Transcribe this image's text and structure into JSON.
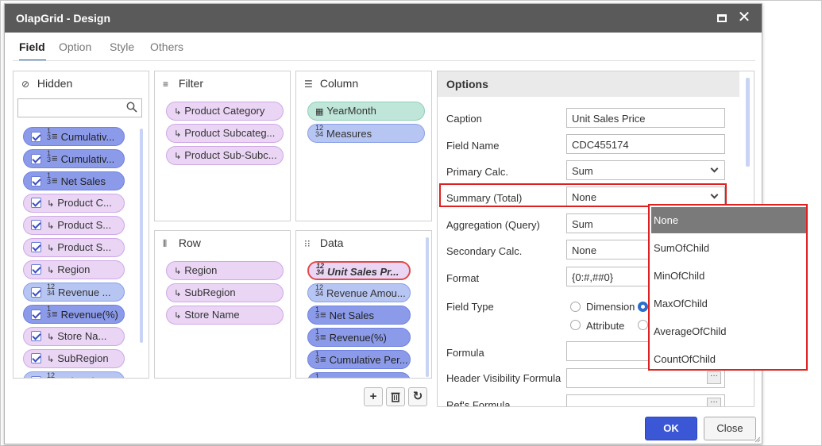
{
  "window": {
    "title": "OlapGrid - Design"
  },
  "tabs": [
    {
      "label": "Field",
      "active": true
    },
    {
      "label": "Option",
      "active": false
    },
    {
      "label": "Style",
      "active": false
    },
    {
      "label": "Others",
      "active": false
    }
  ],
  "hidden": {
    "title": "Hidden",
    "search_placeholder": "",
    "items": [
      {
        "label": "Cumulativ...",
        "icon": "measure-icon",
        "style": "blue-strong"
      },
      {
        "label": "Cumulativ...",
        "icon": "measure-icon",
        "style": "blue-strong"
      },
      {
        "label": "Net Sales",
        "icon": "measure-icon",
        "style": "blue-strong"
      },
      {
        "label": "Product C...",
        "icon": "dimension-icon",
        "style": "purple"
      },
      {
        "label": "Product S...",
        "icon": "dimension-icon",
        "style": "purple"
      },
      {
        "label": "Product S...",
        "icon": "dimension-icon",
        "style": "purple"
      },
      {
        "label": "Region",
        "icon": "dimension-icon",
        "style": "purple"
      },
      {
        "label": "Revenue ...",
        "icon": "number-icon",
        "style": "blue"
      },
      {
        "label": "Revenue(%)",
        "icon": "measure-icon",
        "style": "blue-strong"
      },
      {
        "label": "Store Na...",
        "icon": "dimension-icon",
        "style": "purple"
      },
      {
        "label": "SubRegion",
        "icon": "dimension-icon",
        "style": "purple"
      },
      {
        "label": "Unit Sales",
        "icon": "number-icon",
        "style": "blue"
      }
    ]
  },
  "filter": {
    "title": "Filter",
    "items": [
      {
        "label": "Product Category"
      },
      {
        "label": "Product Subcateg..."
      },
      {
        "label": "Product Sub-Subc..."
      }
    ]
  },
  "column": {
    "title": "Column",
    "items": [
      {
        "label": "YearMonth",
        "icon": "calendar-icon",
        "style": "teal"
      },
      {
        "label": "Measures",
        "icon": "number-icon",
        "style": "blue"
      }
    ]
  },
  "row": {
    "title": "Row",
    "items": [
      {
        "label": "Region"
      },
      {
        "label": "SubRegion"
      },
      {
        "label": "Store Name"
      }
    ]
  },
  "data": {
    "title": "Data",
    "items": [
      {
        "label": "Unit Sales Pr...",
        "icon": "number-icon",
        "style": "selected"
      },
      {
        "label": "Revenue Amou...",
        "icon": "number-icon",
        "style": "blue"
      },
      {
        "label": "Net Sales",
        "icon": "measure-icon",
        "style": "blue-strong"
      },
      {
        "label": "Revenue(%)",
        "icon": "measure-icon",
        "style": "blue-strong"
      },
      {
        "label": "Cumulative Per...",
        "icon": "measure-icon",
        "style": "blue-strong"
      },
      {
        "label": "Cumulative Per...",
        "icon": "measure-icon",
        "style": "blue-strong"
      }
    ]
  },
  "icons": {
    "measure": "1/3≡",
    "number": "12/34",
    "dimension": "↳",
    "calendar": "▦"
  },
  "options": {
    "title": "Options",
    "caption_label": "Caption",
    "caption_value": "Unit Sales Price",
    "field_name_label": "Field Name",
    "field_name_value": "CDC455174",
    "primary_calc_label": "Primary Calc.",
    "primary_calc_value": "Sum",
    "summary_label": "Summary (Total)",
    "summary_value": "None",
    "aggregation_label": "Aggregation (Query)",
    "aggregation_value": "Sum",
    "secondary_calc_label": "Secondary Calc.",
    "secondary_calc_value": "None",
    "format_label": "Format",
    "format_value": "{0:#,##0}",
    "field_type_label": "Field Type",
    "field_type_opt1": "Dimension",
    "field_type_opt2": "Attribute",
    "formula_label": "Formula",
    "header_visibility_label": "Header Visibility Formula",
    "refs_formula_label": "Ref's Formula"
  },
  "summary_dropdown": {
    "options": [
      "None",
      "SumOfChild",
      "MinOfChild",
      "MaxOfChild",
      "AverageOfChild",
      "CountOfChild"
    ],
    "selected": "None"
  },
  "buttons": {
    "add": "+",
    "delete": "🗑",
    "refresh": "↻",
    "ok": "OK",
    "close": "Close"
  },
  "colors": {
    "titlebar": "#5a5a5a",
    "accent": "#3b57d6",
    "highlight": "#e02020"
  }
}
